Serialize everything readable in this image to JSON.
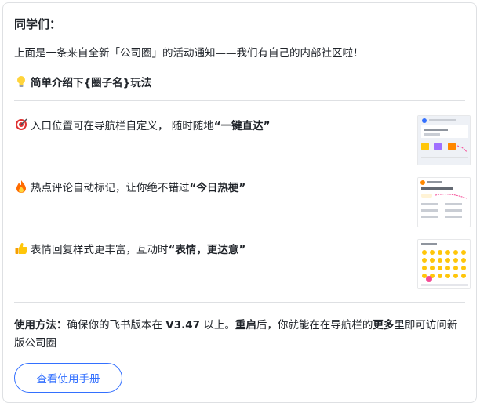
{
  "greeting": "同学们：",
  "announcement": "上面是一条来自全新「公司圈」的活动通知——我们有自己的内部社区啦！",
  "intro": "简单介绍下{圈子名}玩法",
  "features": [
    {
      "icon": "target-icon",
      "text": "入口位置可在导航栏自定义，  随时随地",
      "highlight": "“一键直达”"
    },
    {
      "icon": "fire-icon",
      "text": "热点评论自动标记，让你绝不错过",
      "highlight": "“今日热梗”"
    },
    {
      "icon": "thumbs-up-icon",
      "text": "表情回复样式更丰富，互动时",
      "highlight": "“表情，更达意”"
    }
  ],
  "usage": {
    "label": "使用方法：",
    "text1": "确保你的飞书版本在 ",
    "version": "V3.47",
    "text2": " 以上。",
    "restart": "重启",
    "text3": "后，你就能在在导航栏的",
    "more": "更多",
    "text4": "里即可访问新版公司圈"
  },
  "button_label": "查看使用手册",
  "colors": {
    "accent": "#3370ff",
    "border": "#dee0e3",
    "text": "#1f2329"
  }
}
